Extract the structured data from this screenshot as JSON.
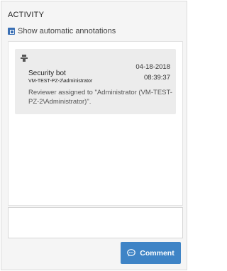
{
  "panel": {
    "title": "ACTIVITY",
    "toggle": {
      "label": "Show automatic annotations",
      "checked": true
    }
  },
  "feed": {
    "entries": [
      {
        "icon": "bot-icon",
        "author": "Security bot",
        "account": "VM-TEST-PZ-2\\administrator",
        "date": "04-18-2018",
        "time": "08:39:37",
        "message": "Reviewer assigned to \"Administrator (VM-TEST-PZ-2\\Administrator)\"."
      }
    ]
  },
  "composer": {
    "placeholder": "",
    "button_label": "Comment",
    "button_icon": "chat-icon",
    "accent": "#3f84c6"
  }
}
